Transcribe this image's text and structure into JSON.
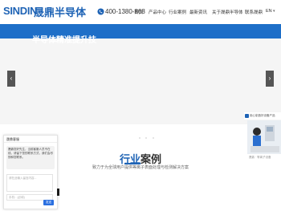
{
  "header": {
    "logo_text": "SINDIN",
    "logo_cn": "晟鼎半导体",
    "phone": "400-1380-868",
    "nav": [
      "首页",
      "产品中心",
      "行业案例",
      "最新资讯",
      "关于晟鼎半导体",
      "联系晟鼎"
    ],
    "lang": "EN"
  },
  "hero": {
    "title": "半导体精准提升技",
    "prev_label": "‹",
    "next_label": "›"
  },
  "section": {
    "title_a": "行业",
    "title_b": "案例",
    "subtitle": "致力于为全球用户提供等离子表面处理与检测解决方案"
  },
  "chat": {
    "header": "晟鼎客服",
    "message": "晟鼎您好先生，当前客服人员不在线，请留下您的联系方式，我们会尽快和您联系。",
    "textarea_placeholder": "请在此输入留言内容...",
    "phone_placeholder": "手机：(必填)",
    "send_label": "发送"
  },
  "promo": {
    "label": "用心制造好设备产品",
    "caption": "晟鼎 · 等离子设备"
  },
  "colors": {
    "brand": "#1e63b5",
    "hero_band": "#1e6fc8",
    "send": "#2a6fe0"
  }
}
